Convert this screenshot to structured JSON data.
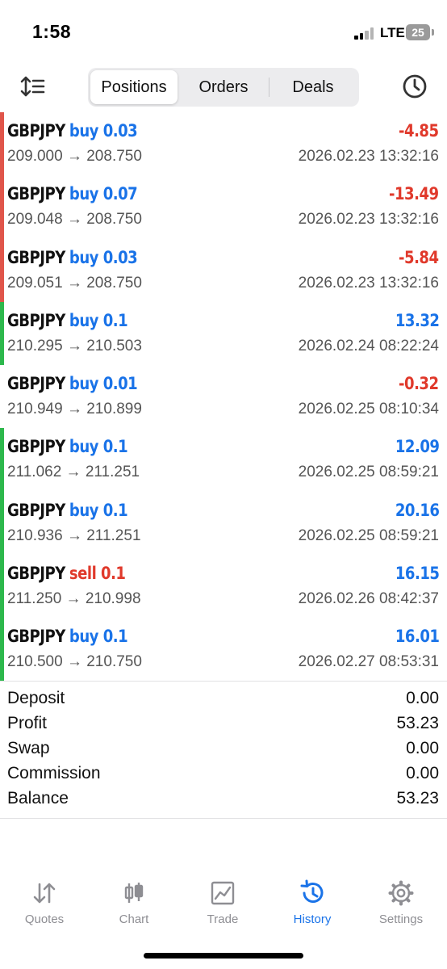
{
  "status_bar": {
    "time": "1:58",
    "network": "LTE",
    "battery": "25"
  },
  "colors": {
    "accent": "#1a73e8",
    "loss": "#e0392b",
    "profit_blue": "#1a73e8",
    "bar_red": "#e0554a",
    "bar_green": "#2db84c",
    "muted": "#8e8e93"
  },
  "toolbar": {
    "sort_icon": "sort-icon",
    "tabs": [
      "Positions",
      "Orders",
      "Deals"
    ],
    "active_tab": "Positions",
    "clock_icon": "clock-icon"
  },
  "positions": [
    {
      "symbol": "GBPJPY",
      "side": "buy 0.03",
      "direction": "buy",
      "profit": "-4.85",
      "prices": "209.000 → 208.750",
      "time": "2026.02.23 13:32:16",
      "bar": "red"
    },
    {
      "symbol": "GBPJPY",
      "side": "buy 0.07",
      "direction": "buy",
      "profit": "-13.49",
      "prices": "209.048 → 208.750",
      "time": "2026.02.23 13:32:16",
      "bar": "red"
    },
    {
      "symbol": "GBPJPY",
      "side": "buy 0.03",
      "direction": "buy",
      "profit": "-5.84",
      "prices": "209.051 → 208.750",
      "time": "2026.02.23 13:32:16",
      "bar": "red"
    },
    {
      "symbol": "GBPJPY",
      "side": "buy 0.1",
      "direction": "buy",
      "profit": "13.32",
      "prices": "210.295 → 210.503",
      "time": "2026.02.24 08:22:24",
      "bar": "green"
    },
    {
      "symbol": "GBPJPY",
      "side": "buy 0.01",
      "direction": "buy",
      "profit": "-0.32",
      "prices": "210.949 → 210.899",
      "time": "2026.02.25 08:10:34",
      "bar": "none"
    },
    {
      "symbol": "GBPJPY",
      "side": "buy 0.1",
      "direction": "buy",
      "profit": "12.09",
      "prices": "211.062 → 211.251",
      "time": "2026.02.25 08:59:21",
      "bar": "green"
    },
    {
      "symbol": "GBPJPY",
      "side": "buy 0.1",
      "direction": "buy",
      "profit": "20.16",
      "prices": "210.936 → 211.251",
      "time": "2026.02.25 08:59:21",
      "bar": "green"
    },
    {
      "symbol": "GBPJPY",
      "side": "sell 0.1",
      "direction": "sell",
      "profit": "16.15",
      "prices": "211.250 → 210.998",
      "time": "2026.02.26 08:42:37",
      "bar": "green"
    },
    {
      "symbol": "GBPJPY",
      "side": "buy 0.1",
      "direction": "buy",
      "profit": "16.01",
      "prices": "210.500 → 210.750",
      "time": "2026.02.27 08:53:31",
      "bar": "green"
    }
  ],
  "summary": [
    {
      "label": "Deposit",
      "value": "0.00"
    },
    {
      "label": "Profit",
      "value": "53.23"
    },
    {
      "label": "Swap",
      "value": "0.00"
    },
    {
      "label": "Commission",
      "value": "0.00"
    },
    {
      "label": "Balance",
      "value": "53.23"
    }
  ],
  "tabbar": {
    "items": [
      {
        "label": "Quotes",
        "icon": "quotes-icon"
      },
      {
        "label": "Chart",
        "icon": "chart-icon"
      },
      {
        "label": "Trade",
        "icon": "trade-icon"
      },
      {
        "label": "History",
        "icon": "history-icon"
      },
      {
        "label": "Settings",
        "icon": "settings-icon"
      }
    ],
    "active": "History"
  }
}
